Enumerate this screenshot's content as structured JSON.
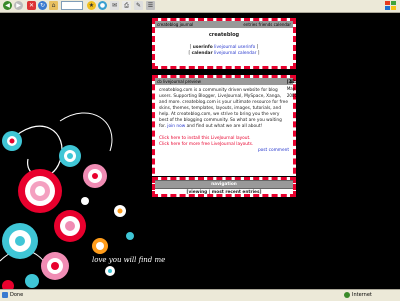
{
  "toolbar": {
    "nav_icons": [
      "back-icon",
      "forward-icon",
      "stop-icon",
      "refresh-icon",
      "home-icon",
      "search-icon",
      "favorites-icon",
      "history-icon",
      "mail-icon",
      "print-icon",
      "edit-icon"
    ]
  },
  "module1": {
    "header_left": "createblog journal",
    "header_right": "entries  friends  calendar",
    "title": "createblog",
    "line1_label": "userinfo",
    "line1_link": "livejournal userinfo",
    "line2_label": "calendar",
    "line2_link": "livejournal calendar"
  },
  "module2": {
    "header_left": "cb livejournal preview",
    "header_date": "[29 May 2005",
    "header_time": "12:31am",
    "paragraph_pre": "createblog.com is a community driven website for blog users. Supporting Blogger, LiveJournal, MySpace, Xanga, and more. createblog.com is your ultimate resource for free skins, themes, templates, layouts, images, tutorials, and help. At createblog.com, we strive to bring you the very best of the blogging community. So what are you waiting for.",
    "join_link": "join now",
    "paragraph_post": "and find out what we are all about!",
    "install_link": "Click here to install this LiveJournal layout.",
    "more_link": "Click here for more free LiveJournal layouts.",
    "post_comment": "post comment"
  },
  "module3": {
    "header": "navigation",
    "nav_text": "[viewing | most recent entries]"
  },
  "tagline": "love you will find me",
  "statusbar": {
    "left": "Done",
    "right": "Internet"
  }
}
